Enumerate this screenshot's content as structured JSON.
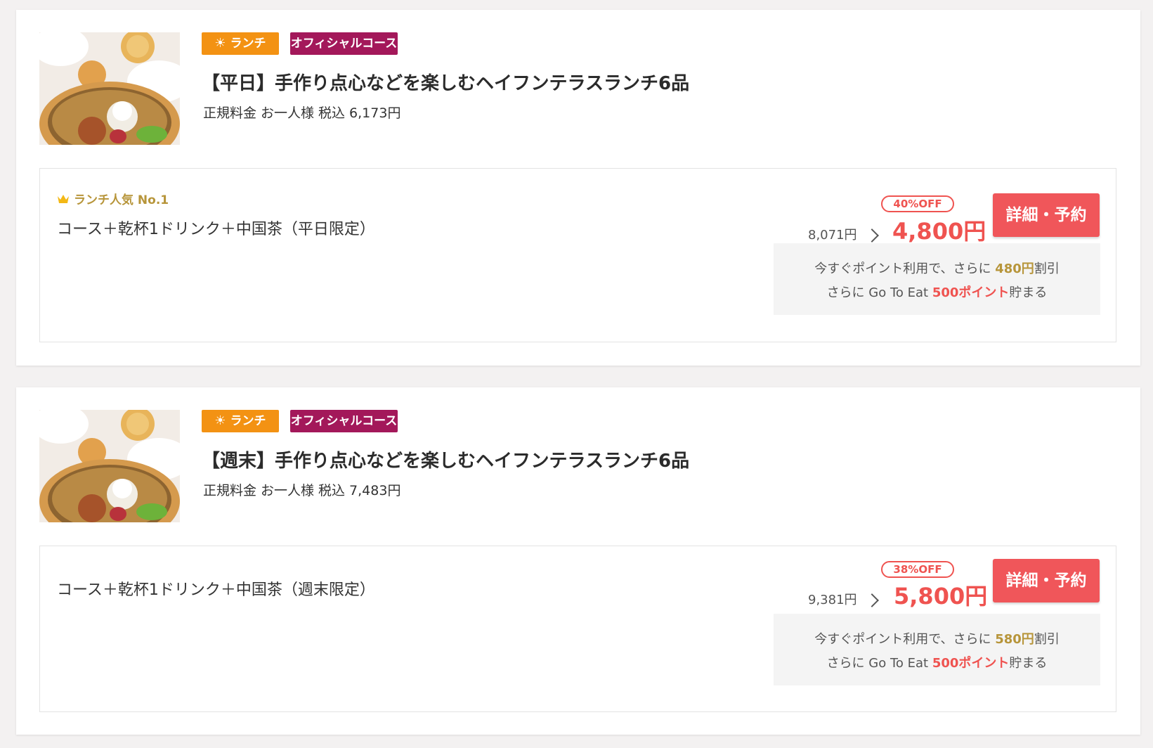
{
  "courses": [
    {
      "badges": {
        "lunch": "ランチ",
        "official": "オフィシャルコース"
      },
      "title": "【平日】手作り点心などを楽しむヘイフンテラスランチ6品",
      "regular_price": {
        "label": "正規料金",
        "per_person": "お一人様",
        "tax": "税込",
        "amount": "6,173円"
      },
      "plan": {
        "popular_label": "ランチ人気 No.1",
        "name": "コース＋乾杯1ドリンク＋中国茶（平日限定）",
        "discount": "40%OFF",
        "original_price": "8,071円",
        "price": "4,800円",
        "button": "詳細・予約",
        "points": {
          "line1_prefix": "今すぐポイント利用で、さらに",
          "line1_amount": "480円",
          "line1_suffix": "割引",
          "line2_prefix": "さらに Go To Eat",
          "line2_points": "500ポイント",
          "line2_suffix": "貯まる"
        }
      }
    },
    {
      "badges": {
        "lunch": "ランチ",
        "official": "オフィシャルコース"
      },
      "title": "【週末】手作り点心などを楽しむヘイフンテラスランチ6品",
      "regular_price": {
        "label": "正規料金",
        "per_person": "お一人様",
        "tax": "税込",
        "amount": "7,483円"
      },
      "plan": {
        "name": "コース＋乾杯1ドリンク＋中国茶（週末限定）",
        "discount": "38%OFF",
        "original_price": "9,381円",
        "price": "5,800円",
        "button": "詳細・予約",
        "points": {
          "line1_prefix": "今すぐポイント利用で、さらに",
          "line1_amount": "580円",
          "line1_suffix": "割引",
          "line2_prefix": "さらに Go To Eat",
          "line2_points": "500ポイント",
          "line2_suffix": "貯まる"
        }
      }
    }
  ],
  "icons": {
    "sun": "sun-icon",
    "crown": "crown-icon",
    "chevron": "chevron-right-icon"
  },
  "colors": {
    "lunch_badge": "#f39213",
    "official_badge": "#a3185a",
    "price_red": "#ef5350",
    "gold": "#b7953a"
  }
}
